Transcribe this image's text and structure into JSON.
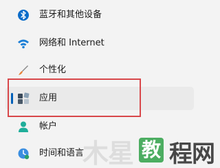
{
  "nav": {
    "items": [
      {
        "label": "蓝牙和其他设备",
        "icon": "bluetooth-icon"
      },
      {
        "label": "网络和 Internet",
        "icon": "wifi-icon"
      },
      {
        "label": "个性化",
        "icon": "brush-icon"
      },
      {
        "label": "应用",
        "icon": "apps-icon",
        "selected": true
      },
      {
        "label": "帐户",
        "icon": "account-icon"
      },
      {
        "label": "时间和语言",
        "icon": "clock-globe-icon"
      }
    ]
  },
  "watermark": {
    "text_left": "木星",
    "badge": "教",
    "text_right": "程网"
  },
  "colors": {
    "accent": "#005fb8",
    "highlight": "#d8474a",
    "selected_bg": "#eaeaea"
  }
}
